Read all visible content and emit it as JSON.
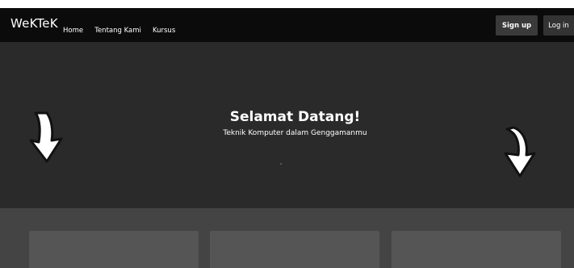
{
  "navbar": {
    "brand": "WeKTeK",
    "links": [
      "Home",
      "Tentang Kami",
      "Kursus"
    ],
    "signup_label": "Sign up",
    "login_label": "Log in"
  },
  "hero": {
    "title": "Selamat Datang!",
    "subtitle": "Teknik Komputer dalam Genggamanmu"
  },
  "icons": {
    "left_arrow": "down-arrow-icon",
    "right_arrow": "down-arrow-icon"
  },
  "colors": {
    "navbar_bg": "#0b0b0b",
    "hero_bg": "#2a2a2a",
    "section_bg": "#444444",
    "card_bg": "#555555"
  }
}
